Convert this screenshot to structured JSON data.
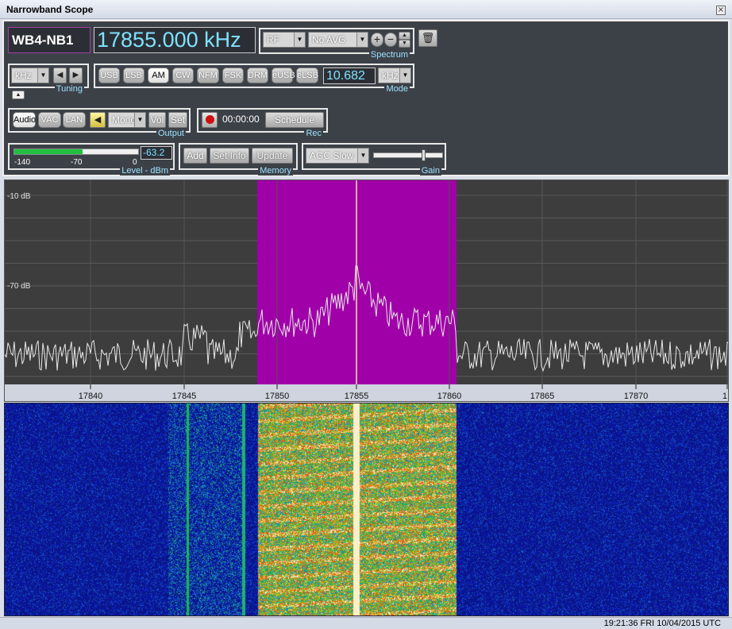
{
  "window": {
    "title": "Narrowband Scope",
    "close": "×"
  },
  "receiver": {
    "name": "WB4-NB1",
    "frequency": "17855.000 kHz"
  },
  "spectrum": {
    "label": "Spectrum",
    "source": "RF",
    "averaging": "No AVG",
    "zoom_in": "+",
    "zoom_out": "−"
  },
  "tuning": {
    "label": "Tuning",
    "unit": "kHz"
  },
  "mode": {
    "label": "Mode",
    "buttons": [
      "USB",
      "LSB",
      "AM",
      "CW",
      "NFM",
      "FSK",
      "DRM",
      "eUSB",
      "eLSB"
    ],
    "active": "AM",
    "bandwidth": "10.682",
    "bandwidth_unit": "kHz"
  },
  "output": {
    "label": "Output",
    "buttons": [
      "Audio",
      "VAC",
      "LAN"
    ],
    "channel": "Mono",
    "vol": "Vol",
    "set": "Set"
  },
  "rec": {
    "label": "Rec",
    "time": "00:00:00",
    "schedule": "Schedule"
  },
  "level": {
    "label": "Level - dBm",
    "value": "-63.2",
    "ticks": [
      "-140",
      "-70",
      "0"
    ],
    "fill_fraction": 0.55
  },
  "memory": {
    "label": "Memory",
    "add": "Add",
    "set_info": "Set Info",
    "update": "Update"
  },
  "agc": {
    "label": "Gain",
    "mode": "AGC Slow",
    "gain_fraction": 0.72
  },
  "scope": {
    "db_labels": [
      "-10 dB",
      "-70 dB"
    ],
    "freq_ticks": [
      "17840",
      "17845",
      "17850",
      "17855",
      "17860",
      "17865",
      "17870",
      "1"
    ],
    "passband_color": "#a000a8",
    "trace_color": "#e8e8e8",
    "center_color": "#f5e6a0"
  },
  "status": {
    "timestamp": "19:21:36 FRI 10/04/2015 UTC"
  }
}
